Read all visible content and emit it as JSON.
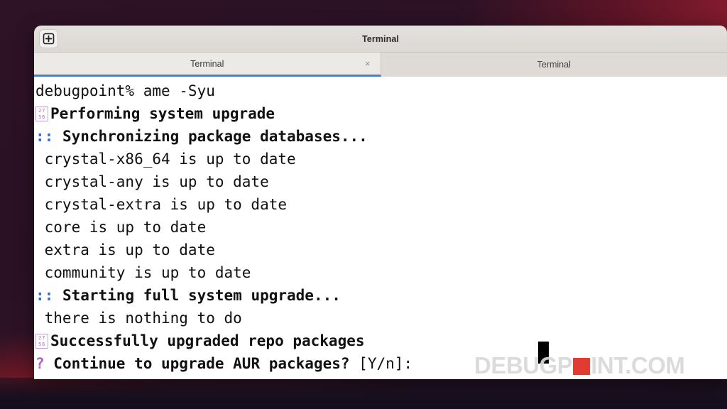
{
  "desktop": {
    "background_colors": [
      "#2e1226",
      "#8c1d2e",
      "#9d1f26",
      "#150d1b"
    ]
  },
  "window": {
    "title": "Terminal",
    "new_tab_icon": "plus-in-box-icon"
  },
  "tabs": [
    {
      "label": "Terminal",
      "active": true,
      "close_glyph": "×"
    },
    {
      "label": "Terminal",
      "active": false
    }
  ],
  "terminal": {
    "accent_blue": "#3584e4",
    "prefix_blue": "#2d6fd4",
    "prefix_purple": "#a866c8",
    "background": "#ffffff",
    "foreground": "#111111",
    "cursor": "block",
    "lines": [
      {
        "prefix": "",
        "text": "debugpoint% ame -Syu",
        "bold": false
      },
      {
        "prefix": "tofu",
        "tofu_hi": "27",
        "tofu_lo": "56",
        "text": "Performing system upgrade",
        "bold": true
      },
      {
        "prefix": "::",
        "text": "Synchronizing package databases...",
        "bold": true
      },
      {
        "prefix": "",
        "text": " crystal-x86_64 is up to date",
        "bold": false
      },
      {
        "prefix": "",
        "text": " crystal-any is up to date",
        "bold": false
      },
      {
        "prefix": "",
        "text": " crystal-extra is up to date",
        "bold": false
      },
      {
        "prefix": "",
        "text": " core is up to date",
        "bold": false
      },
      {
        "prefix": "",
        "text": " extra is up to date",
        "bold": false
      },
      {
        "prefix": "",
        "text": " community is up to date",
        "bold": false
      },
      {
        "prefix": "::",
        "text": "Starting full system upgrade...",
        "bold": true
      },
      {
        "prefix": "",
        "text": " there is nothing to do",
        "bold": false
      },
      {
        "prefix": "tofu",
        "tofu_hi": "27",
        "tofu_lo": "56",
        "text": "Successfully upgraded repo packages",
        "bold": true
      },
      {
        "prefix": "?",
        "text": "Continue to upgrade AUR packages?",
        "bold": true,
        "suffix": " [Y/n]:"
      }
    ]
  },
  "watermark": {
    "part1": "DEBUGP",
    "part2": "INT.COM",
    "accent_color": "#e02b20"
  }
}
